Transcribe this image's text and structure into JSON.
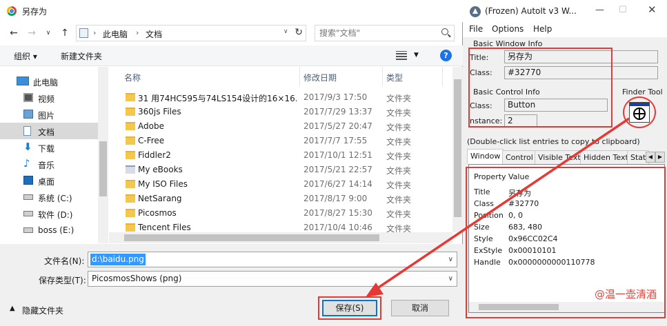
{
  "save_dialog": {
    "title": "另存为",
    "address": {
      "segments": [
        "此电脑",
        "文档"
      ]
    },
    "search": {
      "placeholder": "搜索\"文档\""
    },
    "toolbar": {
      "organize": "组织 ▾",
      "new_folder": "新建文件夹"
    },
    "nav_items": [
      {
        "label": "此电脑",
        "icon": "computer-icon"
      },
      {
        "label": "视频",
        "icon": "video-icon"
      },
      {
        "label": "图片",
        "icon": "picture-icon"
      },
      {
        "label": "文档",
        "icon": "document-icon",
        "selected": true
      },
      {
        "label": "下载",
        "icon": "download-icon"
      },
      {
        "label": "音乐",
        "icon": "music-icon"
      },
      {
        "label": "桌面",
        "icon": "desktop-icon"
      },
      {
        "label": "系统 (C:)",
        "icon": "drive-icon"
      },
      {
        "label": "软件 (D:)",
        "icon": "drive-icon"
      },
      {
        "label": "boss (E:)",
        "icon": "drive-icon"
      }
    ],
    "columns": {
      "name": "名称",
      "date": "修改日期",
      "type": "类型"
    },
    "files": [
      {
        "name": "31 用74HC595与74LS154设计的16×16...",
        "date": "2017/9/3 17:50",
        "type": "文件夹"
      },
      {
        "name": "360js Files",
        "date": "2017/7/29 13:37",
        "type": "文件夹"
      },
      {
        "name": "Adobe",
        "date": "2017/5/27 20:47",
        "type": "文件夹"
      },
      {
        "name": "C-Free",
        "date": "2017/7/7 17:55",
        "type": "文件夹"
      },
      {
        "name": "Fiddler2",
        "date": "2017/10/1 12:51",
        "type": "文件夹"
      },
      {
        "name": "My eBooks",
        "date": "2017/5/21 22:57",
        "type": "文件夹",
        "special": true
      },
      {
        "name": "My ISO Files",
        "date": "2017/6/27 14:14",
        "type": "文件夹"
      },
      {
        "name": "NetSarang",
        "date": "2017/8/17 9:00",
        "type": "文件夹"
      },
      {
        "name": "Picosmos",
        "date": "2017/8/27 15:30",
        "type": "文件夹"
      },
      {
        "name": "Tencent Files",
        "date": "2017/10/4 10:46",
        "type": "文件夹"
      }
    ],
    "filename_label": "文件名(N):",
    "filename_value": "d:\\baidu.png",
    "filetype_label": "保存类型(T):",
    "filetype_value": "PicosmosShows (png)",
    "hide_folders": "隐藏文件夹",
    "save_button": "保存(S)",
    "cancel_button": "取消"
  },
  "autoit": {
    "title": "(Frozen) AutoIt v3 W...",
    "menu": [
      "File",
      "Options",
      "Help"
    ],
    "basic_window_info": "Basic Window Info",
    "title_label": "Title:",
    "title_value": "另存为",
    "class_label": "Class:",
    "class_value": "#32770",
    "basic_control_info": "Basic Control Info",
    "ctrl_class_label": "Class:",
    "ctrl_class_value": "Button",
    "instance_label": "nstance:",
    "instance_value": "2",
    "finder_tool": "Finder Tool",
    "hint": "(Double-click list entries to copy to clipboard)",
    "tabs": [
      "Window",
      "Control",
      "Visible Text",
      "Hidden Text",
      "Stat"
    ],
    "prop_headers": {
      "property": "Property",
      "value": "Value"
    },
    "properties": [
      {
        "k": "Title",
        "v": "另存为"
      },
      {
        "k": "Class",
        "v": "#32770"
      },
      {
        "k": "Position",
        "v": "0, 0"
      },
      {
        "k": "Size",
        "v": "683, 480"
      },
      {
        "k": "Style",
        "v": "0x96CC02C4"
      },
      {
        "k": "ExStyle",
        "v": "0x00010101"
      },
      {
        "k": "Handle",
        "v": "0x0000000000110778"
      }
    ]
  },
  "watermark": "@温一壶清酒",
  "colors": {
    "annotation_red": "#e53935",
    "selection_blue": "#3399ff",
    "accent_blue": "#0078d7"
  }
}
